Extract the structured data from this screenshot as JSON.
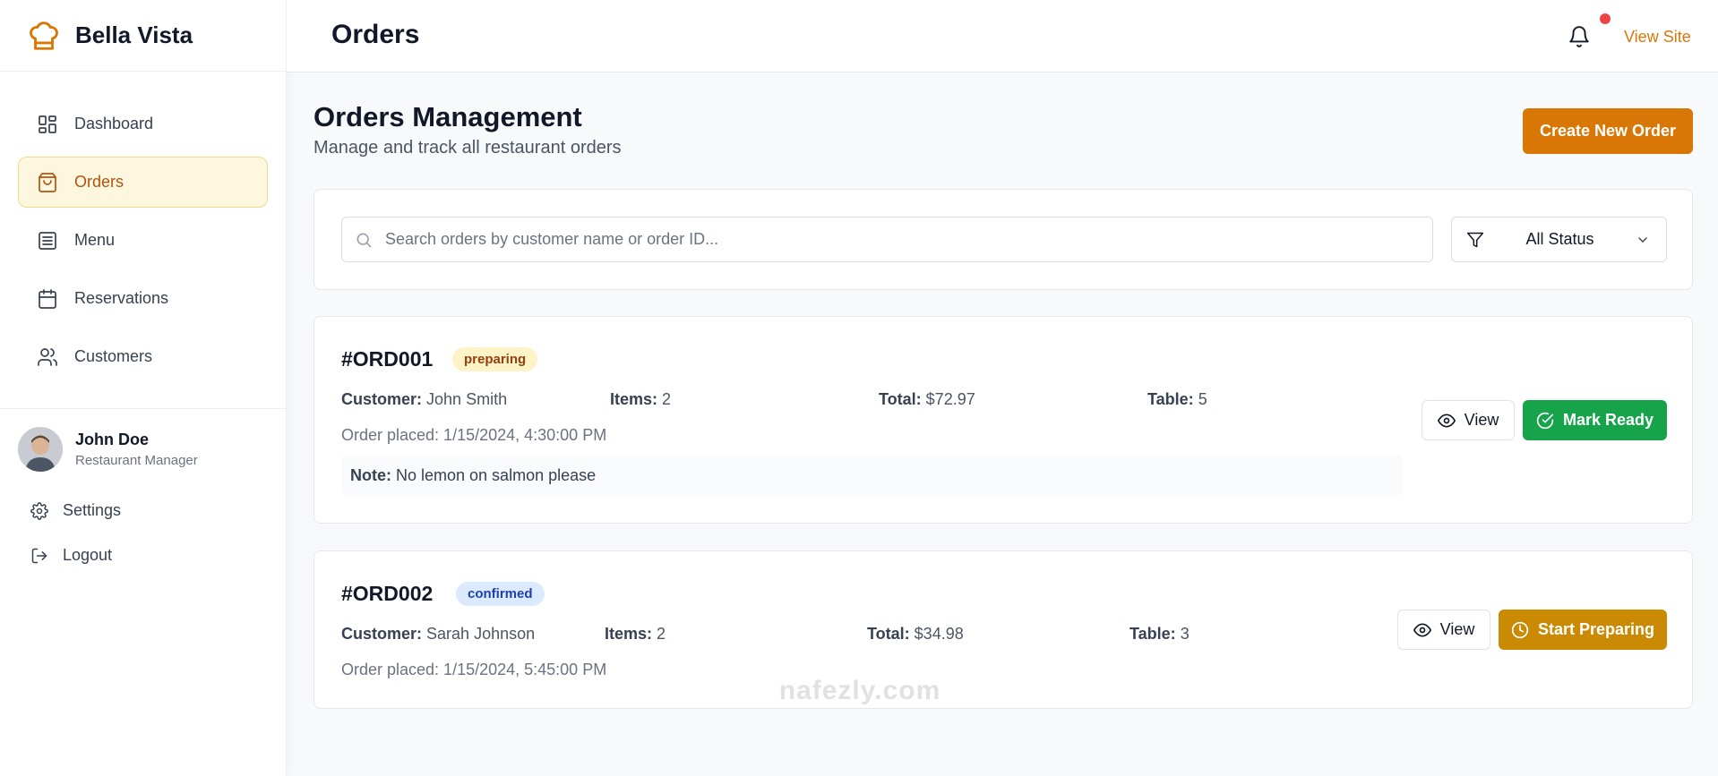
{
  "sidebar": {
    "brand": "Bella Vista",
    "brand_icon": "chef-hat-icon",
    "items": [
      {
        "label": "Dashboard",
        "icon": "dashboard-icon"
      },
      {
        "label": "Orders",
        "icon": "shopping-bag-icon",
        "active": true
      },
      {
        "label": "Menu",
        "icon": "menu-list-icon"
      },
      {
        "label": "Reservations",
        "icon": "calendar-icon"
      },
      {
        "label": "Customers",
        "icon": "users-icon"
      }
    ],
    "profile": {
      "name": "John Doe",
      "role": "Restaurant Manager"
    },
    "settings_label": "Settings",
    "logout_label": "Logout"
  },
  "header": {
    "title": "Orders",
    "view_site_label": "View Site"
  },
  "main": {
    "title": "Orders Management",
    "subtitle": "Manage and track all restaurant orders",
    "create_label": "Create New Order",
    "search_placeholder": "Search orders by customer name or order ID...",
    "status_filter": "All Status"
  },
  "orders": [
    {
      "id": "#ORD001",
      "status": "preparing",
      "customer_label": "Customer:",
      "customer": "John Smith",
      "items_label": "Items:",
      "items": "2",
      "total_label": "Total:",
      "total": "$72.97",
      "table_label": "Table:",
      "table": "5",
      "placed": "Order placed: 1/15/2024, 4:30:00 PM",
      "note_label": "Note:",
      "note": "No lemon on salmon please",
      "view_label": "View",
      "action_label": "Mark Ready"
    },
    {
      "id": "#ORD002",
      "status": "confirmed",
      "customer_label": "Customer:",
      "customer": "Sarah Johnson",
      "items_label": "Items:",
      "items": "2",
      "total_label": "Total:",
      "total": "$34.98",
      "table_label": "Table:",
      "table": "3",
      "placed": "Order placed: 1/15/2024, 5:45:00 PM",
      "view_label": "View",
      "action_label": "Start Preparing"
    }
  ],
  "watermark": {
    "text": "nafezly.com"
  },
  "colors": {
    "accent": "#d97706",
    "green": "#16a34a",
    "amber": "#ca8a04",
    "notification": "#ef4444"
  }
}
